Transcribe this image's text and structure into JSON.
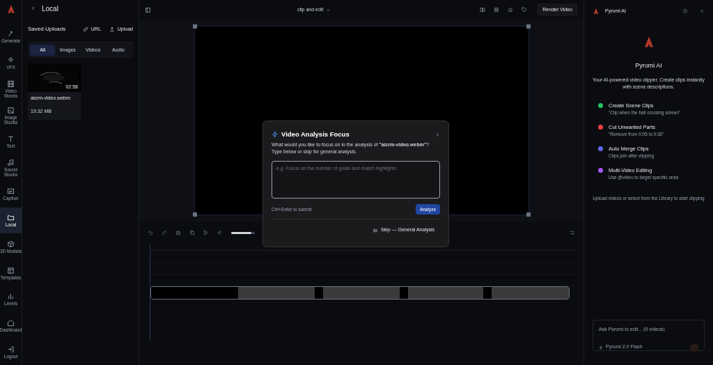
{
  "sidebar": {
    "items": [
      {
        "label": "Generate",
        "selected": false
      },
      {
        "label": "VFX",
        "selected": false
      },
      {
        "label": "Video Stocks",
        "selected": false
      },
      {
        "label": "Image Stocks",
        "selected": false
      },
      {
        "label": "Text",
        "selected": false
      },
      {
        "label": "Sound Stocks",
        "selected": false
      },
      {
        "label": "Caption",
        "selected": false
      },
      {
        "label": "Local",
        "selected": true
      },
      {
        "label": "3D Models",
        "selected": false
      },
      {
        "label": "Templates",
        "selected": false
      },
      {
        "label": "Levels",
        "selected": false
      },
      {
        "label": "Dashboard",
        "selected": false
      },
      {
        "label": "Logout",
        "selected": false
      }
    ]
  },
  "library": {
    "title": "Local",
    "section": "Saved Uploads",
    "actions": [
      "URL",
      "Upload"
    ],
    "tabs": [
      {
        "label": "All",
        "selected": true
      },
      {
        "label": "Images",
        "selected": false
      },
      {
        "label": "Videos",
        "selected": false
      },
      {
        "label": "Audio",
        "selected": false
      }
    ],
    "files": [
      {
        "name": "aicrm-video.webm",
        "duration": "02:58",
        "size": "19.32 MB"
      }
    ]
  },
  "topbar": {
    "project": "clip and edit",
    "render_button": "Render Video"
  },
  "timeline": {
    "zoom": {
      "level": 0.85
    }
  },
  "assistant": {
    "title": "Pyromi AI",
    "heading": "Pyromi AI",
    "intro": "Your AI-powered video clipper. Create clips instantly with scene descriptions.",
    "features": [
      {
        "title": "Create Scene Clips",
        "detail": "\"Clip when the ball crossing screen\"",
        "color": "#22c55e"
      },
      {
        "title": "Cut Unwanted Parts",
        "detail": "\"Remove from 0:05 to 0:30\"",
        "color": "#ef4444"
      },
      {
        "title": "Auto Merge Clips",
        "detail": "Clips join after clipping",
        "color": "#6366f1"
      },
      {
        "title": "Multi-Video Editing",
        "detail": "Use @video to target specific ones",
        "color": "#a855f7"
      }
    ],
    "tip": "Upload videos or select from the Library to start clipping",
    "input_placeholder": "Ask Pyromi to edit... (0 videos)",
    "model": "Pyromi 2.0 Flash"
  },
  "dialog": {
    "title": "Video Analysis Focus",
    "message": "What would you like to focus on in the analysis of **\"aicrm-video.webm\"**? Type below or skip for general analysis.",
    "placeholder": "e.g. Focus on the number of goals and match highlights",
    "hint": "Ctrl+Enter to submit",
    "submit": "Analyze",
    "skip": "Skip — General Analysis"
  }
}
